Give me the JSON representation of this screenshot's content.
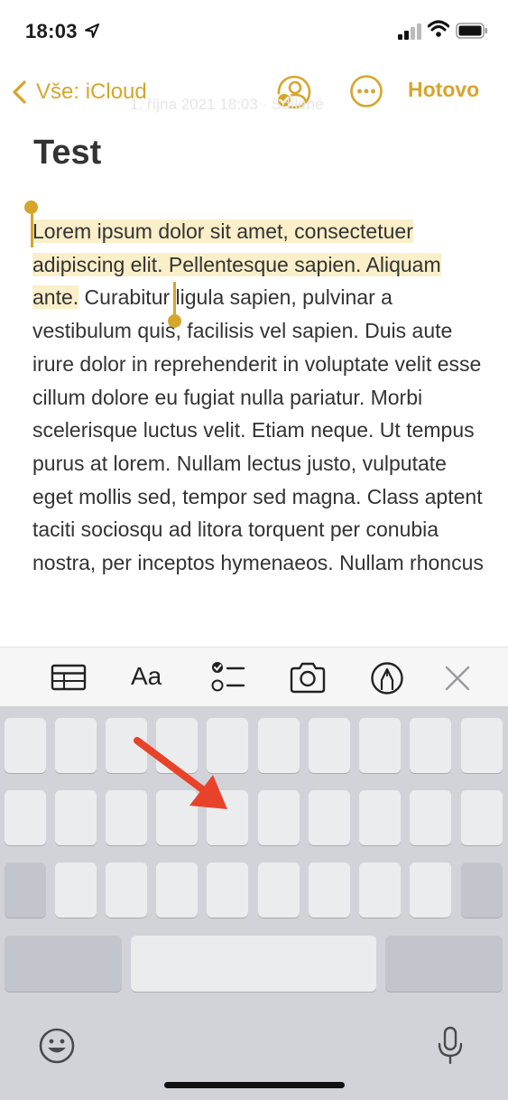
{
  "status_bar": {
    "time": "18:03"
  },
  "nav": {
    "back_label": "Vše: iCloud",
    "done_label": "Hotovo",
    "date_text": "1. října 2021 18:03 · Sdílené"
  },
  "note": {
    "title": "Test",
    "selected_text": "Lorem ipsum dolor sit amet, consectetuer adipiscing elit. Pellentesque sapien. Aliquam ante.",
    "body_text": " Curabitur ligula sapien, pulvinar a vestibulum quis, facilisis vel sapien. Duis aute irure dolor in reprehenderit in voluptate velit esse cillum dolore eu fugiat nulla pariatur. Morbi scelerisque luctus velit. Etiam neque. Ut tempus purus at lorem. Nullam lectus justo, vulputate eget mollis sed, tempor sed magna. Class aptent taciti sociosqu ad litora torquent per conubia nostra, per inceptos hymenaeos. Nullam rhoncus"
  },
  "toolbar": {
    "format_label": "Aa"
  },
  "colors": {
    "accent": "#d6a52c",
    "highlight": "#faefc9",
    "arrow": "#e8432a"
  }
}
